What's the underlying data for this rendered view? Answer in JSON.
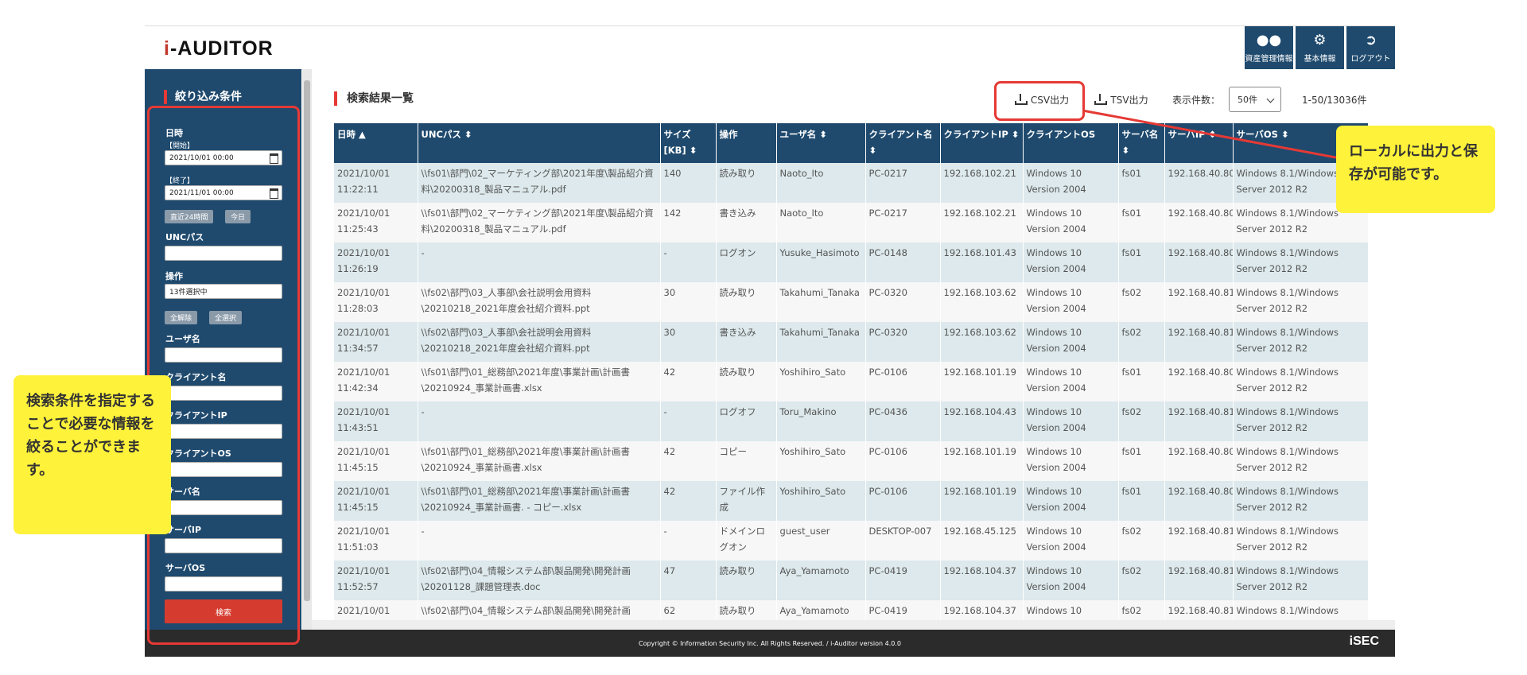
{
  "app": {
    "logo": "i-AUDITOR"
  },
  "topnav": [
    {
      "label": "資産管理情報",
      "icon": "users-icon"
    },
    {
      "label": "基本情報",
      "icon": "gear-icon"
    },
    {
      "label": "ログアウト",
      "icon": "logout-icon"
    }
  ],
  "sidebar": {
    "title": "絞り込み条件",
    "date_label": "日時",
    "start_label": "【開始】",
    "start_value": "2021/10/01 00:00",
    "end_label": "【終了】",
    "end_value": "2021/11/01 00:00",
    "btn_24h": "直近24時間",
    "btn_today": "今日",
    "unc_label": "UNCパス",
    "op_label": "操作",
    "op_value": "13件選択中",
    "btn_clear": "全解除",
    "btn_all": "全選択",
    "user_label": "ユーザ名",
    "client_label": "クライアント名",
    "client_ip_label": "クライアントIP",
    "client_os_label": "クライアントOS",
    "server_label": "サーバ名",
    "server_ip_label": "サーバIP",
    "server_os_label": "サーバOS",
    "search_btn": "検索"
  },
  "main": {
    "title": "検索結果一覧",
    "csv": "CSV出力",
    "tsv": "TSV出力",
    "count_label": "表示件数：",
    "count_value": "50件",
    "range": "1-50/13036件"
  },
  "table": {
    "headers": [
      "日時  ▲",
      "UNCパス  ⬍",
      "サイズ [KB]  ⬍",
      "操作",
      "ユーザ名  ⬍",
      "クライアント名  ⬍",
      "クライアントIP  ⬍",
      "クライアントOS",
      "サーバ名  ⬍",
      "サーバIP  ⬍",
      "サーバOS  ⬍"
    ],
    "rows": [
      [
        "2021/10/01 11:22:11",
        "\\\\fs01\\部門\\02_マーケティング部\\2021年度\\製品紹介資料\\20200318_製品マニュアル.pdf",
        "140",
        "読み取り",
        "Naoto_Ito",
        "PC-0217",
        "192.168.102.21",
        "Windows 10 Version 2004",
        "fs01",
        "192.168.40.80",
        "Windows 8.1/Windows Server 2012 R2"
      ],
      [
        "2021/10/01 11:25:43",
        "\\\\fs01\\部門\\02_マーケティング部\\2021年度\\製品紹介資料\\20200318_製品マニュアル.pdf",
        "142",
        "書き込み",
        "Naoto_Ito",
        "PC-0217",
        "192.168.102.21",
        "Windows 10 Version 2004",
        "fs01",
        "192.168.40.80",
        "Windows 8.1/Windows Server 2012 R2"
      ],
      [
        "2021/10/01 11:26:19",
        "-",
        "-",
        "ログオン",
        "Yusuke_Hasimoto",
        "PC-0148",
        "192.168.101.43",
        "Windows 10 Version 2004",
        "fs01",
        "192.168.40.80",
        "Windows 8.1/Windows Server 2012 R2"
      ],
      [
        "2021/10/01 11:28:03",
        "\\\\fs02\\部門\\03_人事部\\会社説明会用資料\\20210218_2021年度会社紹介資料.ppt",
        "30",
        "読み取り",
        "Takahumi_Tanaka",
        "PC-0320",
        "192.168.103.62",
        "Windows 10 Version 2004",
        "fs02",
        "192.168.40.81",
        "Windows 8.1/Windows Server 2012 R2"
      ],
      [
        "2021/10/01 11:34:57",
        "\\\\fs02\\部門\\03_人事部\\会社説明会用資料\\20210218_2021年度会社紹介資料.ppt",
        "30",
        "書き込み",
        "Takahumi_Tanaka",
        "PC-0320",
        "192.168.103.62",
        "Windows 10 Version 2004",
        "fs02",
        "192.168.40.81",
        "Windows 8.1/Windows Server 2012 R2"
      ],
      [
        "2021/10/01 11:42:34",
        "\\\\fs01\\部門\\01_総務部\\2021年度\\事業計画\\計画書\\20210924_事業計画書.xlsx",
        "42",
        "読み取り",
        "Yoshihiro_Sato",
        "PC-0106",
        "192.168.101.19",
        "Windows 10 Version 2004",
        "fs01",
        "192.168.40.80",
        "Windows 8.1/Windows Server 2012 R2"
      ],
      [
        "2021/10/01 11:43:51",
        "-",
        "-",
        "ログオフ",
        "Toru_Makino",
        "PC-0436",
        "192.168.104.43",
        "Windows 10 Version 2004",
        "fs02",
        "192.168.40.81",
        "Windows 8.1/Windows Server 2012 R2"
      ],
      [
        "2021/10/01 11:45:15",
        "\\\\fs01\\部門\\01_総務部\\2021年度\\事業計画\\計画書\\20210924_事業計画書.xlsx",
        "42",
        "コピー",
        "Yoshihiro_Sato",
        "PC-0106",
        "192.168.101.19",
        "Windows 10 Version 2004",
        "fs01",
        "192.168.40.80",
        "Windows 8.1/Windows Server 2012 R2"
      ],
      [
        "2021/10/01 11:45:15",
        "\\\\fs01\\部門\\01_総務部\\2021年度\\事業計画\\計画書\\20210924_事業計画書. - コピー.xlsx",
        "42",
        "ファイル作成",
        "Yoshihiro_Sato",
        "PC-0106",
        "192.168.101.19",
        "Windows 10 Version 2004",
        "fs01",
        "192.168.40.80",
        "Windows 8.1/Windows Server 2012 R2"
      ],
      [
        "2021/10/01 11:51:03",
        "-",
        "-",
        "ドメインログオン",
        "guest_user",
        "DESKTOP-007",
        "192.168.45.125",
        "Windows 10 Version 2004",
        "fs02",
        "192.168.40.81",
        "Windows 8.1/Windows Server 2012 R2"
      ],
      [
        "2021/10/01 11:52:57",
        "\\\\fs02\\部門\\04_情報システム部\\製品開発\\開発計画\\20201128_課題管理表.doc",
        "47",
        "読み取り",
        "Aya_Yamamoto",
        "PC-0419",
        "192.168.104.37",
        "Windows 10 Version 2004",
        "fs02",
        "192.168.40.81",
        "Windows 8.1/Windows Server 2012 R2"
      ],
      [
        "2021/10/01",
        "\\\\fs02\\部門\\04_情報システム部\\製品開発\\開発計画",
        "62",
        "読み取り",
        "Aya_Yamamoto",
        "PC-0419",
        "192.168.104.37",
        "Windows 10",
        "fs02",
        "192.168.40.81",
        "Windows 8.1/Windows"
      ]
    ]
  },
  "footer": {
    "copyright": "Copyright © Information Security Inc. All Rights Reserved. / i-Auditor version 4.0.0",
    "brand": "iSEC"
  },
  "callouts": {
    "left": "検索条件を指定することで必要な情報を絞ることができます。",
    "right": "ローカルに出力と保存が可能です。"
  },
  "colors": {
    "navy": "#1f4a6e",
    "accent_red": "#e53935",
    "callout_yellow": "#fff23a"
  }
}
